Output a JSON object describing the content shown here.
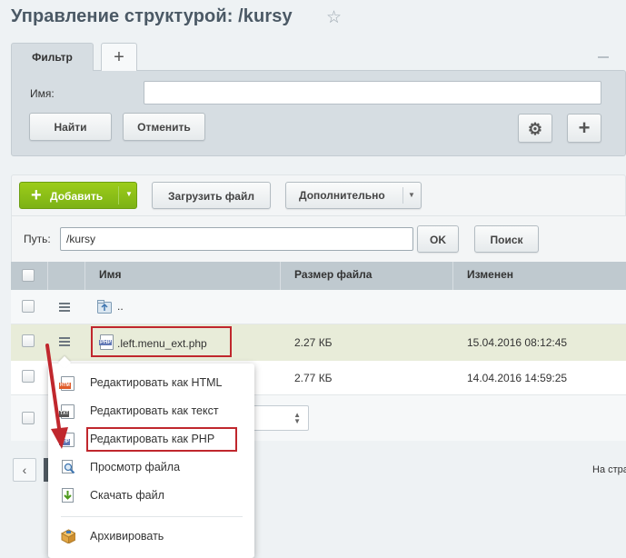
{
  "page": {
    "title": "Управление структурой: /kursy"
  },
  "filter": {
    "tab_label": "Фильтр",
    "name_label": "Имя:",
    "name_value": "",
    "find_label": "Найти",
    "cancel_label": "Отменить"
  },
  "toolbar": {
    "add_label": "Добавить",
    "upload_label": "Загрузить файл",
    "more_label": "Дополнительно"
  },
  "path": {
    "label": "Путь:",
    "value": "/kursy",
    "ok_label": "OK",
    "search_label": "Поиск"
  },
  "table": {
    "columns": [
      "Имя",
      "Размер файла",
      "Изменен"
    ],
    "up_row": {
      "name": ".."
    },
    "rows": [
      {
        "name": ".left.menu_ext.php",
        "size": "2.27 КБ",
        "modified": "15.04.2016 08:12:45"
      },
      {
        "name": "",
        "size": "2.77 КБ",
        "modified": "14.04.2016 14:59:25"
      }
    ]
  },
  "footer": {
    "nav_text": "На стра"
  },
  "context_menu": {
    "items": [
      {
        "label": "Редактировать как HTML",
        "icon": "html-file-icon"
      },
      {
        "label": "Редактировать как текст",
        "icon": "txt-file-icon"
      },
      {
        "label": "Редактировать как PHP",
        "icon": "php-file-icon"
      },
      {
        "label": "Просмотр файла",
        "icon": "magnifier-icon"
      },
      {
        "label": "Скачать файл",
        "icon": "download-icon"
      },
      {
        "label": "Архивировать",
        "icon": "archive-box-icon"
      }
    ]
  },
  "colors": {
    "accent_green": "#8cc11a",
    "highlight_red": "#c0272d",
    "header_bg": "#bfc9cf",
    "selected_row": "#e8ecd9"
  }
}
